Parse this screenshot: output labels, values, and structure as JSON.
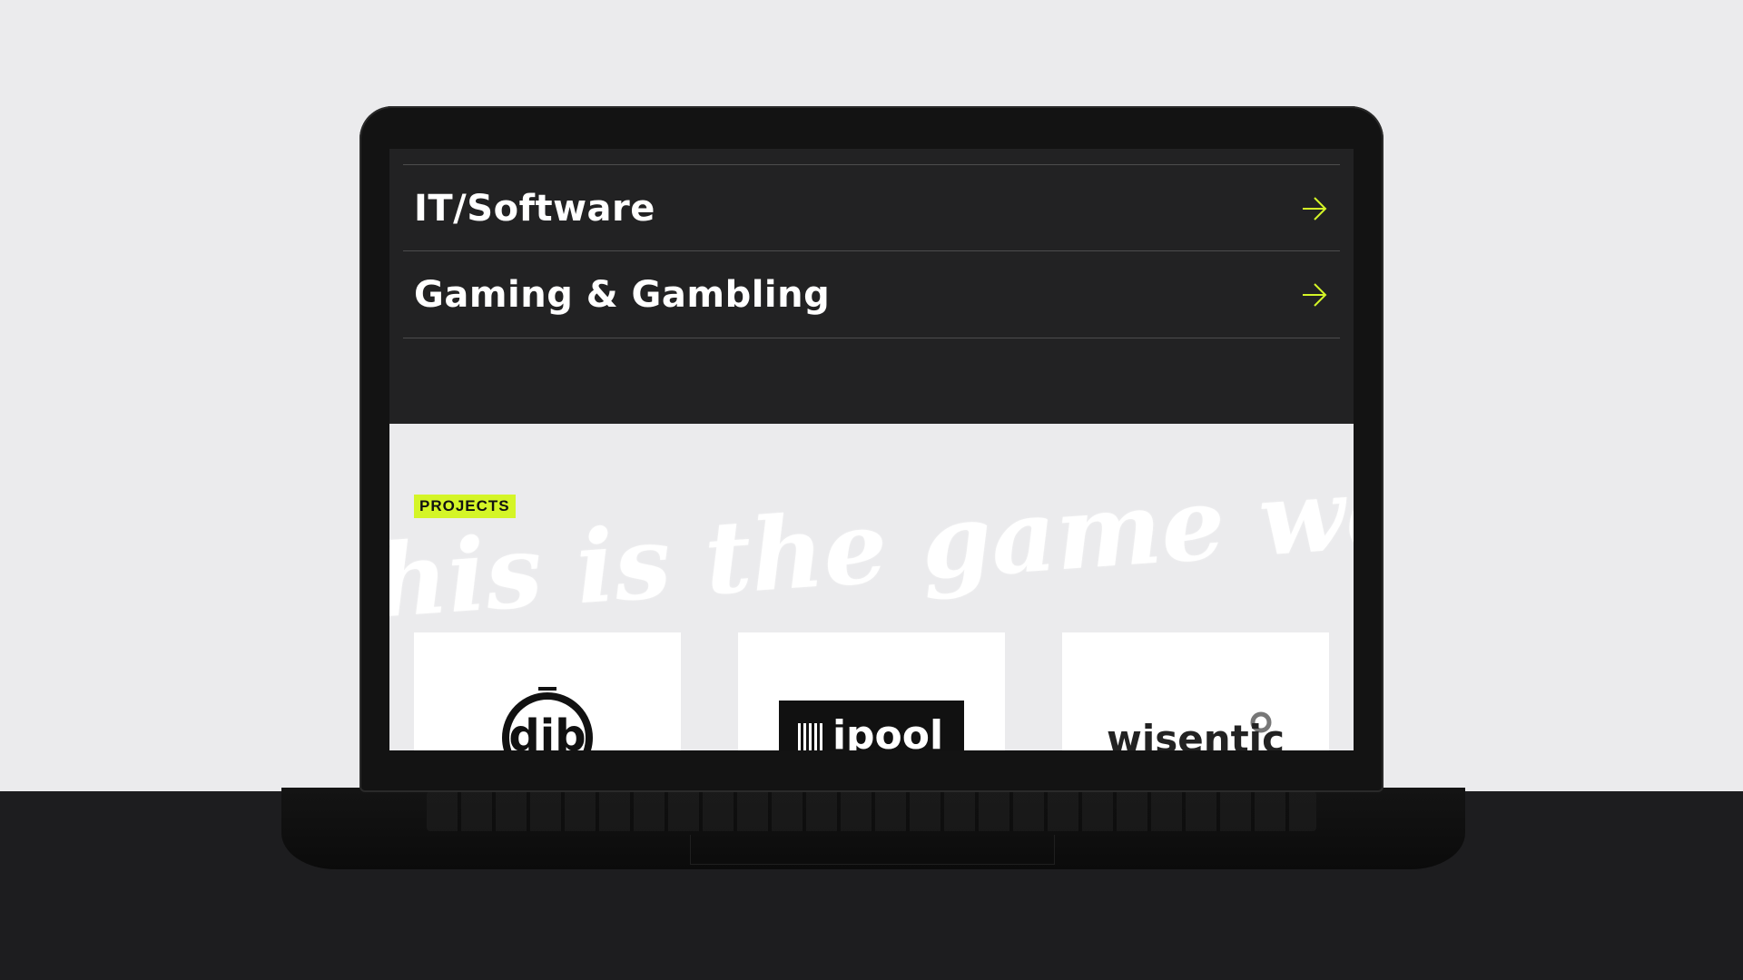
{
  "industries": [
    {
      "label": "IT/Software"
    },
    {
      "label": "Gaming & Gambling"
    }
  ],
  "projects": {
    "badge": "PROJECTS",
    "background_script": "his is the game we play",
    "logos": [
      "dib",
      "ipool",
      "wisentic"
    ]
  },
  "colors": {
    "accent": "#d4f527",
    "dark_bg": "#222223",
    "light_bg": "#ebebed"
  },
  "icons": {
    "row_arrow": "arrow-right-icon"
  }
}
